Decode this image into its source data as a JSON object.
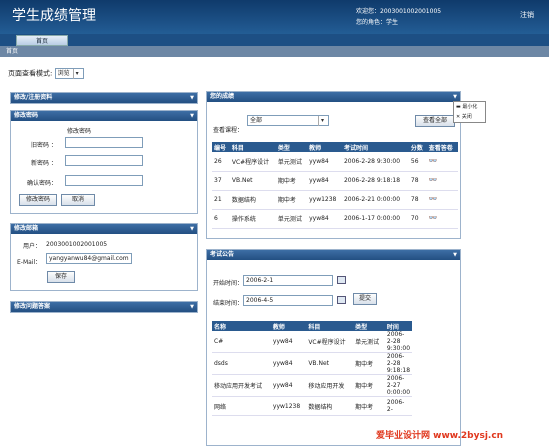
{
  "header": {
    "title": "学生成绩管理",
    "welcome_line": "欢迎您：2003001002001005",
    "role_line": "您的角色：学生",
    "logout": "注销"
  },
  "nav": {
    "tab": "首页",
    "breadcrumb": "首页"
  },
  "view_mode": {
    "label": "页面查看模式:",
    "value": "浏览"
  },
  "left": {
    "panel1": "修改/注册资料",
    "pwd": {
      "title": "修改密码",
      "heading": "修改密码",
      "old": "旧密码 ：",
      "new": "新密码 ：",
      "confirm": "确认密码：",
      "submit": "修改密码",
      "cancel": "取消"
    },
    "mail": {
      "title": "修改邮箱",
      "user_label": "用户：",
      "user_value": "2003001002001005",
      "email_label": "E-Mail：",
      "email_value": "yangyanwu84@gmail.com",
      "save": "保存"
    },
    "qa": "修改问题答案"
  },
  "grades": {
    "title": "您的成绩",
    "filter_label": "查看课程：",
    "filter_value": "全部",
    "view_all": "查看全部",
    "menu": {
      "minimize": "最小化",
      "close": "关闭"
    },
    "columns": [
      "编号",
      "科目",
      "类型",
      "教师",
      "考试时间",
      "分数",
      "查看答卷"
    ],
    "rows": [
      [
        "26",
        "VC#程序设计",
        "单元测试",
        "yyw84",
        "2006-2-28 9:30:00",
        "56"
      ],
      [
        "37",
        "VB.Net",
        "期中考",
        "yyw84",
        "2006-2-28 9:18:18",
        "78"
      ],
      [
        "21",
        "数据结构",
        "期中考",
        "yyw1238",
        "2006-2-21 0:00:00",
        "78"
      ],
      [
        "6",
        "操作系统",
        "单元测试",
        "yyw84",
        "2006-1-17 0:00:00",
        "70"
      ]
    ]
  },
  "exams": {
    "title": "考试公告",
    "start_label": "开始时间：",
    "start_value": "2006-2-1",
    "end_label": "结束时间：",
    "end_value": "2006-4-5",
    "submit": "提交",
    "columns": [
      "名称",
      "教师",
      "科目",
      "类型",
      "时间"
    ],
    "rows": [
      [
        "C#",
        "yyw84",
        "VC#程序设计",
        "单元测试",
        "2006-2-28 9:30:00"
      ],
      [
        "dsds",
        "yyw84",
        "VB.Net",
        "期中考",
        "2006-2-28 9:18:18"
      ],
      [
        "移动应用开发考试",
        "yyw84",
        "移动应用开发",
        "期中考",
        "2006-2-27 0:00:00"
      ],
      [
        "网络",
        "yyw1238",
        "数据结构",
        "期中考",
        "2006-2-"
      ]
    ]
  },
  "watermark": "爱毕业设计网 www.2bysj.cn"
}
